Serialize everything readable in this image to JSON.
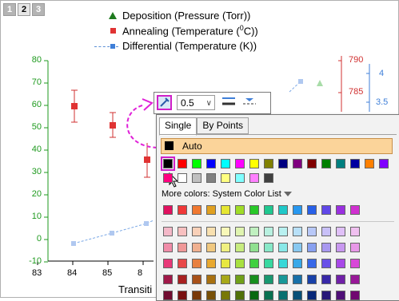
{
  "page_tabs": [
    "1",
    "2",
    "3"
  ],
  "legend": [
    {
      "label": "Deposition (Pressure (Torr))",
      "icon": "triangle-icon",
      "color": "#1e7a1e"
    },
    {
      "label_pre": "Annealing (Temperature (",
      "sup": "0",
      "label_post": "C))",
      "icon": "square-icon",
      "color": "#e03333"
    },
    {
      "label": "Differential (Temperature (K))",
      "icon": "line-square-icon",
      "color": "#3f7fd8"
    }
  ],
  "axes": {
    "left_ticks": [
      "80",
      "70",
      "60",
      "50",
      "40",
      "30",
      "20",
      "10",
      "0",
      "-10"
    ],
    "right1_ticks": [
      "790",
      "785"
    ],
    "right2_ticks": [
      "4",
      "3.5"
    ],
    "x_ticks": [
      "83",
      "84",
      "85",
      "8"
    ],
    "x_label": "Transiti"
  },
  "toolbar": {
    "width_value": "0.5"
  },
  "popup": {
    "tabs": [
      "Single",
      "By Points"
    ],
    "auto_label": "Auto",
    "more_colors_label": "More colors: System Color List",
    "basic_colors": [
      "#000000",
      "#ff0000",
      "#00ff00",
      "#0000ff",
      "#00ffff",
      "#ff00ff",
      "#ffff00",
      "#808000",
      "#000080",
      "#800080",
      "#800000",
      "#008000",
      "#008080",
      "#0000a0",
      "#ff8000",
      "#8000ff",
      "#ff0080",
      "#ffffff",
      "#c0c0c0",
      "#808080",
      "#ffff80",
      "#80ffff",
      "#ff80ff",
      "#404040"
    ],
    "system_row": [
      "#e0115f",
      "#f03838",
      "#f07830",
      "#e0a020",
      "#e6e632",
      "#a0dc28",
      "#28c828",
      "#20c890",
      "#20c8c8",
      "#2898f0",
      "#2860e8",
      "#6048e8",
      "#9a30e0",
      "#d030d0"
    ],
    "palette_rows": [
      [
        "#f4b8c8",
        "#f8c0c0",
        "#f8d0b8",
        "#f8e0b0",
        "#f8f8b8",
        "#e0f4b0",
        "#c0f0c0",
        "#b8f0e0",
        "#b8f0f0",
        "#b8e0f8",
        "#b8c8f8",
        "#c8c0f8",
        "#e0c0f8",
        "#f0c0f0"
      ],
      [
        "#f08ca8",
        "#f09898",
        "#f0b090",
        "#f0c880",
        "#f0f080",
        "#c8ec80",
        "#90e090",
        "#88e8c8",
        "#88e8e8",
        "#88c8f0",
        "#88a0f0",
        "#a898f0",
        "#c898f0",
        "#e898e8"
      ],
      [
        "#e83878",
        "#e84848",
        "#e88040",
        "#e8a830",
        "#e8e840",
        "#a8e040",
        "#40d040",
        "#38d8a0",
        "#38d8d8",
        "#38a8e8",
        "#3868e8",
        "#6850e8",
        "#a848e8",
        "#d848d8"
      ],
      [
        "#a01848",
        "#a82020",
        "#a85018",
        "#a87010",
        "#a8a818",
        "#70a018",
        "#18901e",
        "#189870",
        "#189898",
        "#1870a8",
        "#1840a8",
        "#3828a8",
        "#7020a8",
        "#981898"
      ],
      [
        "#700c30",
        "#781010",
        "#783808",
        "#785008",
        "#787808",
        "#507008",
        "#086810",
        "#087050",
        "#087070",
        "#085078",
        "#082878",
        "#281878",
        "#501078",
        "#700870"
      ]
    ]
  }
}
